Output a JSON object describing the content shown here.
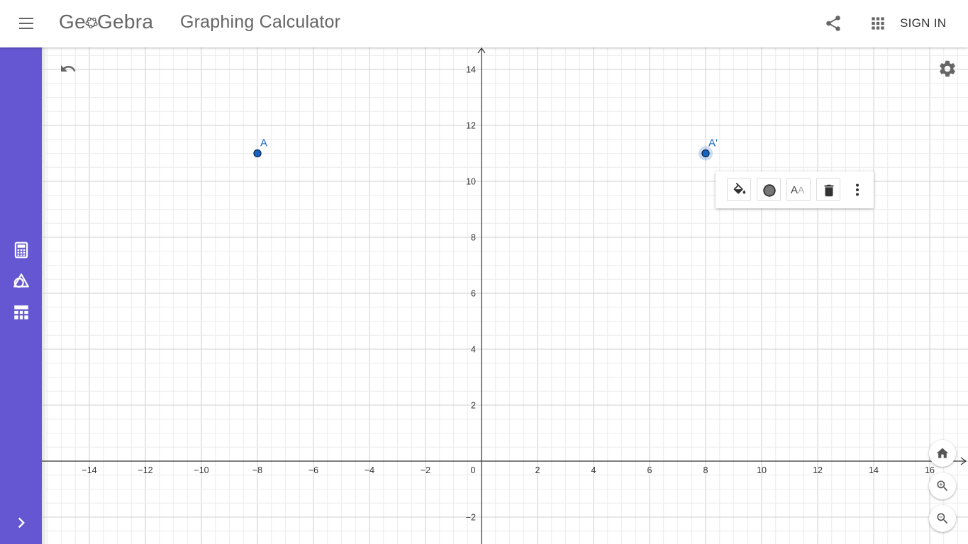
{
  "header": {
    "logo_text_pre": "Ge",
    "logo_text_post": "Gebra",
    "title": "Graphing Calculator",
    "signin_label": "SIGN IN",
    "icons": [
      "menu-icon",
      "share-icon",
      "apps-grid-icon"
    ]
  },
  "sidebar": {
    "items": [
      {
        "name": "algebra-calculator-icon"
      },
      {
        "name": "tools-icon"
      },
      {
        "name": "table-view-icon"
      }
    ],
    "expand_icon": "chevron-right-icon",
    "color": "#6557d2"
  },
  "graphics": {
    "x_ticks": [
      "−14",
      "−12",
      "−10",
      "−8",
      "−6",
      "−4",
      "−2",
      "0",
      "2",
      "4",
      "6",
      "8",
      "10",
      "12",
      "14",
      "16"
    ],
    "x_values": [
      -14,
      -12,
      -10,
      -8,
      -6,
      -4,
      -2,
      0,
      2,
      4,
      6,
      8,
      10,
      12,
      14,
      16
    ],
    "y_ticks": [
      "14",
      "12",
      "10",
      "8",
      "6",
      "4",
      "2",
      "−2"
    ],
    "y_values": [
      14,
      12,
      10,
      8,
      6,
      4,
      2,
      -2
    ],
    "points": [
      {
        "label": "A",
        "x": -8,
        "y": 11,
        "selected": false
      },
      {
        "label": "A'",
        "x": 8,
        "y": 11,
        "selected": true
      }
    ],
    "point_color": "#1565c0"
  },
  "stylebar": {
    "buttons": [
      "fill-color-icon",
      "point-style-icon",
      "text-size-icon",
      "delete-icon",
      "more-vert-icon"
    ],
    "text_size_label_big": "A",
    "text_size_label_small": "A"
  },
  "controls": {
    "undo": "undo-icon",
    "settings": "settings-icon",
    "zoom": [
      "home-icon",
      "zoom-in-icon",
      "zoom-out-icon"
    ]
  }
}
